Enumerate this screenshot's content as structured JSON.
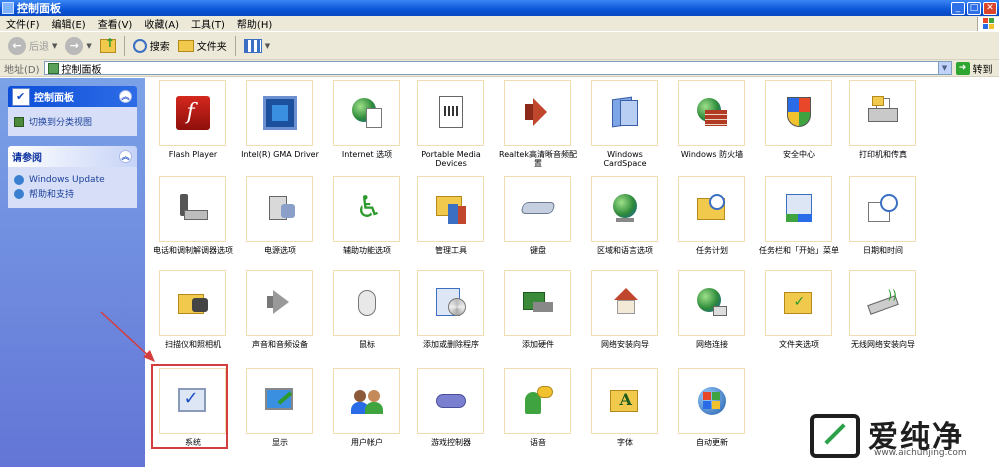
{
  "window": {
    "title": "控制面板"
  },
  "menubar": {
    "items": [
      "文件(F)",
      "编辑(E)",
      "查看(V)",
      "收藏(A)",
      "工具(T)",
      "帮助(H)"
    ]
  },
  "toolbar": {
    "back": "后退",
    "search": "搜索",
    "folders": "文件夹"
  },
  "address": {
    "label": "地址(D)",
    "value": "控制面板",
    "go": "转到"
  },
  "taskpane": {
    "panel1_title": "控制面板",
    "switch_view": "切换到分类视图",
    "panel2_title": "请参阅",
    "windows_update": "Windows Update",
    "help_support": "帮助和支持"
  },
  "items": [
    {
      "label": "Flash Player",
      "icon": "flash-icon"
    },
    {
      "label": "Intel(R) GMA Driver",
      "icon": "intel-gma-icon"
    },
    {
      "label": "Internet 选项",
      "icon": "internet-options-icon"
    },
    {
      "label": "Portable Media Devices",
      "icon": "portable-media-icon"
    },
    {
      "label": "Realtek高清晰音频配置",
      "icon": "realtek-audio-icon"
    },
    {
      "label": "Windows CardSpace",
      "icon": "cardspace-icon"
    },
    {
      "label": "Windows 防火墙",
      "icon": "firewall-icon"
    },
    {
      "label": "安全中心",
      "icon": "security-center-icon"
    },
    {
      "label": "打印机和传真",
      "icon": "printer-icon"
    },
    {
      "label": "电话和调制解调器选项",
      "icon": "phone-modem-icon"
    },
    {
      "label": "电源选项",
      "icon": "power-options-icon"
    },
    {
      "label": "辅助功能选项",
      "icon": "accessibility-icon"
    },
    {
      "label": "管理工具",
      "icon": "admin-tools-icon"
    },
    {
      "label": "键盘",
      "icon": "keyboard-icon"
    },
    {
      "label": "区域和语言选项",
      "icon": "region-language-icon"
    },
    {
      "label": "任务计划",
      "icon": "scheduled-tasks-icon"
    },
    {
      "label": "任务栏和「开始」菜单",
      "icon": "taskbar-start-icon"
    },
    {
      "label": "日期和时间",
      "icon": "date-time-icon"
    },
    {
      "label": "扫描仪和照相机",
      "icon": "scanner-camera-icon"
    },
    {
      "label": "声音和音频设备",
      "icon": "sound-icon"
    },
    {
      "label": "鼠标",
      "icon": "mouse-icon"
    },
    {
      "label": "添加或删除程序",
      "icon": "add-remove-programs-icon"
    },
    {
      "label": "添加硬件",
      "icon": "add-hardware-icon"
    },
    {
      "label": "网络安装向导",
      "icon": "network-setup-icon"
    },
    {
      "label": "网络连接",
      "icon": "network-connections-icon"
    },
    {
      "label": "文件夹选项",
      "icon": "folder-options-icon"
    },
    {
      "label": "无线网络安装向导",
      "icon": "wireless-setup-icon"
    },
    {
      "label": "系统",
      "icon": "system-icon"
    },
    {
      "label": "显示",
      "icon": "display-icon"
    },
    {
      "label": "用户帐户",
      "icon": "user-accounts-icon"
    },
    {
      "label": "游戏控制器",
      "icon": "game-controllers-icon"
    },
    {
      "label": "语音",
      "icon": "speech-icon"
    },
    {
      "label": "字体",
      "icon": "fonts-icon"
    },
    {
      "label": "自动更新",
      "icon": "automatic-updates-icon"
    }
  ],
  "watermark": {
    "text": "爱纯净",
    "url": "www.aichunjing.com"
  },
  "colors": {
    "titlebar": "#0a55d6",
    "taskpane": "#6f8ee0",
    "highlight": "#d43d3d"
  }
}
